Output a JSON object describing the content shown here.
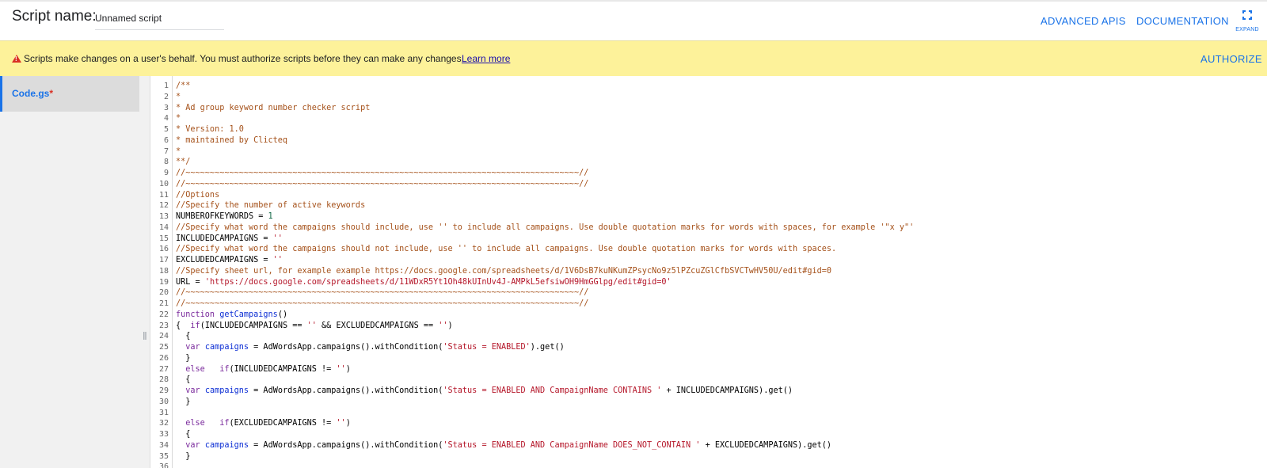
{
  "header": {
    "script_label": "Script name:",
    "script_name_value": "Unnamed script",
    "advanced_apis_label": "ADVANCED APIS",
    "documentation_label": "DOCUMENTATION",
    "expand_label": "EXPAND"
  },
  "banner": {
    "message": "Scripts make changes on a user's behalf. You must authorize scripts before they can make any changes.",
    "learn_more_label": "Learn more",
    "authorize_label": "AUTHORIZE"
  },
  "sidebar": {
    "files": [
      {
        "name": "Code.gs",
        "modified_marker": "*"
      }
    ]
  },
  "colors": {
    "accent": "#1a73e8",
    "banner_bg": "#fdf29a",
    "warning": "#d93025",
    "comment": "#a5511a",
    "string": "#b5172a",
    "keyword": "#7a2a9c",
    "function": "#0c2ed4"
  },
  "editor": {
    "lines": [
      [
        {
          "t": "comment",
          "v": "/**"
        }
      ],
      [
        {
          "t": "comment",
          "v": "*"
        }
      ],
      [
        {
          "t": "comment",
          "v": "* Ad group keyword number checker script"
        }
      ],
      [
        {
          "t": "comment",
          "v": "*"
        }
      ],
      [
        {
          "t": "comment",
          "v": "* Version: 1.0"
        }
      ],
      [
        {
          "t": "comment",
          "v": "* maintained by Clicteq"
        }
      ],
      [
        {
          "t": "comment",
          "v": "*"
        }
      ],
      [
        {
          "t": "comment",
          "v": "**/"
        }
      ],
      [
        {
          "t": "comment",
          "v": "//~~~~~~~~~~~~~~~~~~~~~~~~~~~~~~~~~~~~~~~~~~~~~~~~~~~~~~~~~~~~~~~~~~~~~~~~~~~~~~~~~//"
        }
      ],
      [
        {
          "t": "comment",
          "v": "//~~~~~~~~~~~~~~~~~~~~~~~~~~~~~~~~~~~~~~~~~~~~~~~~~~~~~~~~~~~~~~~~~~~~~~~~~~~~~~~~~//"
        }
      ],
      [
        {
          "t": "comment",
          "v": "//Options"
        }
      ],
      [
        {
          "t": "comment",
          "v": "//Specify the number of active keywords"
        }
      ],
      [
        {
          "t": "plain",
          "v": "NUMBEROFKEYWORDS = "
        },
        {
          "t": "number",
          "v": "1"
        }
      ],
      [
        {
          "t": "comment",
          "v": "//Specify what word the campaigns should include, use '' to include all campaigns. Use double quotation marks for words with spaces, for example '\"x y\"'"
        }
      ],
      [
        {
          "t": "plain",
          "v": "INCLUDEDCAMPAIGNS = "
        },
        {
          "t": "string",
          "v": "''"
        }
      ],
      [
        {
          "t": "comment",
          "v": "//Specify what word the campaigns should not include, use '' to include all campaigns. Use double quotation marks for words with spaces."
        }
      ],
      [
        {
          "t": "plain",
          "v": "EXCLUDEDCAMPAIGNS = "
        },
        {
          "t": "string",
          "v": "''"
        }
      ],
      [
        {
          "t": "comment",
          "v": "//Specify sheet url, for example example https://docs.google.com/spreadsheets/d/1V6DsB7kuNKumZPsycNo9z5lPZcuZGlCfbSVCTwHV50U/edit#gid=0"
        }
      ],
      [
        {
          "t": "plain",
          "v": "URL = "
        },
        {
          "t": "string",
          "v": "'https://docs.google.com/spreadsheets/d/11WDxR5Yt1Oh48kUInUv4J-AMPkL5efsiwOH9HmGGlpg/edit#gid=0'"
        }
      ],
      [
        {
          "t": "comment",
          "v": "//~~~~~~~~~~~~~~~~~~~~~~~~~~~~~~~~~~~~~~~~~~~~~~~~~~~~~~~~~~~~~~~~~~~~~~~~~~~~~~~~~//"
        }
      ],
      [
        {
          "t": "comment",
          "v": "//~~~~~~~~~~~~~~~~~~~~~~~~~~~~~~~~~~~~~~~~~~~~~~~~~~~~~~~~~~~~~~~~~~~~~~~~~~~~~~~~~//"
        }
      ],
      [
        {
          "t": "keyword",
          "v": "function "
        },
        {
          "t": "function",
          "v": "getCampaigns"
        },
        {
          "t": "plain",
          "v": "()"
        }
      ],
      [
        {
          "t": "plain",
          "v": "{  "
        },
        {
          "t": "keyword",
          "v": "if"
        },
        {
          "t": "plain",
          "v": "(INCLUDEDCAMPAIGNS == "
        },
        {
          "t": "string",
          "v": "''"
        },
        {
          "t": "plain",
          "v": " && EXCLUDEDCAMPAIGNS == "
        },
        {
          "t": "string",
          "v": "''"
        },
        {
          "t": "plain",
          "v": ")"
        }
      ],
      [
        {
          "t": "plain",
          "v": "  {"
        }
      ],
      [
        {
          "t": "plain",
          "v": "  "
        },
        {
          "t": "keyword",
          "v": "var "
        },
        {
          "t": "function",
          "v": "campaigns"
        },
        {
          "t": "plain",
          "v": " = AdWordsApp.campaigns().withCondition("
        },
        {
          "t": "string",
          "v": "'Status = ENABLED'"
        },
        {
          "t": "plain",
          "v": ").get()"
        }
      ],
      [
        {
          "t": "plain",
          "v": "  }"
        }
      ],
      [
        {
          "t": "plain",
          "v": "  "
        },
        {
          "t": "keyword",
          "v": "else   if"
        },
        {
          "t": "plain",
          "v": "(INCLUDEDCAMPAIGNS != "
        },
        {
          "t": "string",
          "v": "''"
        },
        {
          "t": "plain",
          "v": ")"
        }
      ],
      [
        {
          "t": "plain",
          "v": "  {"
        }
      ],
      [
        {
          "t": "plain",
          "v": "  "
        },
        {
          "t": "keyword",
          "v": "var "
        },
        {
          "t": "function",
          "v": "campaigns"
        },
        {
          "t": "plain",
          "v": " = AdWordsApp.campaigns().withCondition("
        },
        {
          "t": "string",
          "v": "'Status = ENABLED AND CampaignName CONTAINS '"
        },
        {
          "t": "plain",
          "v": " + INCLUDEDCAMPAIGNS).get()"
        }
      ],
      [
        {
          "t": "plain",
          "v": "  }"
        }
      ],
      [
        {
          "t": "plain",
          "v": ""
        }
      ],
      [
        {
          "t": "plain",
          "v": "  "
        },
        {
          "t": "keyword",
          "v": "else   if"
        },
        {
          "t": "plain",
          "v": "(EXCLUDEDCAMPAIGNS != "
        },
        {
          "t": "string",
          "v": "''"
        },
        {
          "t": "plain",
          "v": ")"
        }
      ],
      [
        {
          "t": "plain",
          "v": "  {"
        }
      ],
      [
        {
          "t": "plain",
          "v": "  "
        },
        {
          "t": "keyword",
          "v": "var "
        },
        {
          "t": "function",
          "v": "campaigns"
        },
        {
          "t": "plain",
          "v": " = AdWordsApp.campaigns().withCondition("
        },
        {
          "t": "string",
          "v": "'Status = ENABLED AND CampaignName DOES_NOT_CONTAIN '"
        },
        {
          "t": "plain",
          "v": " + EXCLUDEDCAMPAIGNS).get()"
        }
      ],
      [
        {
          "t": "plain",
          "v": "  }"
        }
      ],
      [
        {
          "t": "plain",
          "v": ""
        }
      ]
    ]
  }
}
